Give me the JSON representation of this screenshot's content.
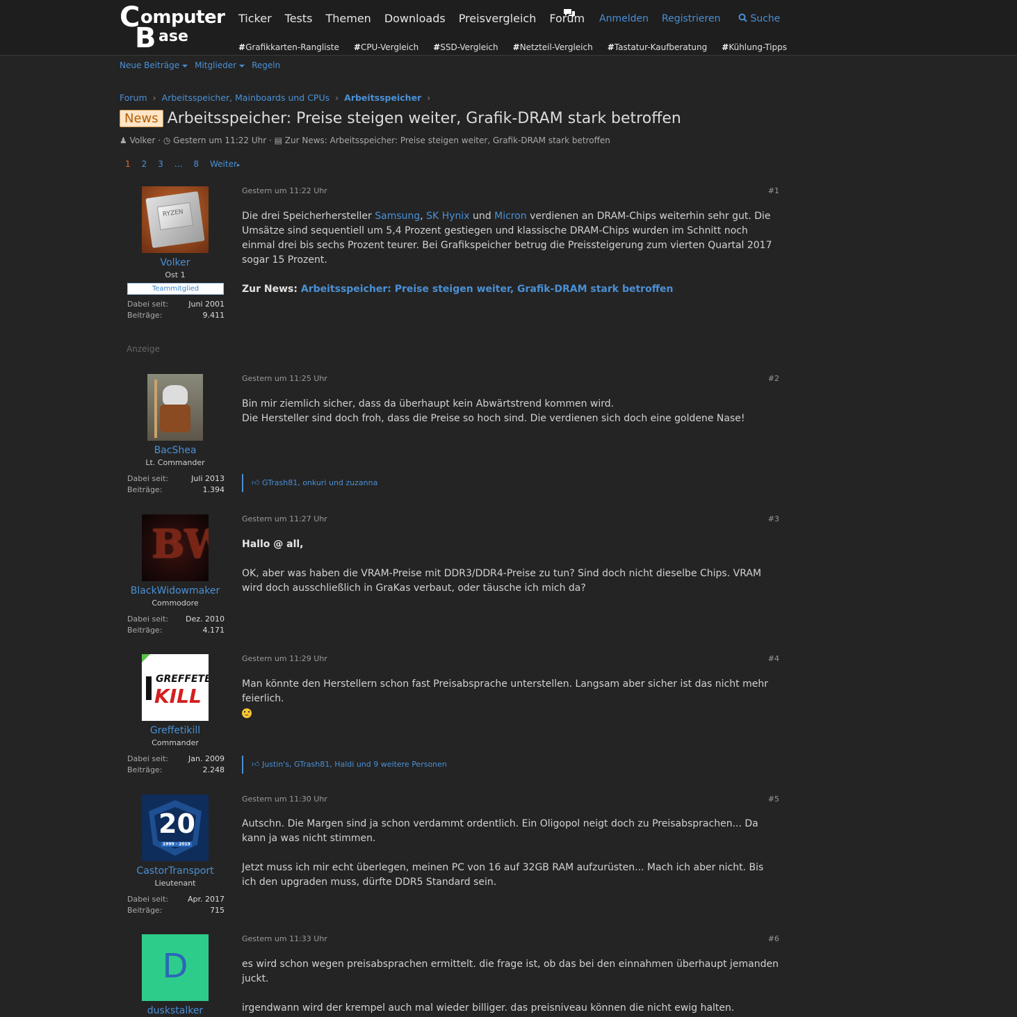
{
  "logo": {
    "line1": "C",
    "line1b": "omputer",
    "line2": "B",
    "line2b": "ase"
  },
  "nav": {
    "items": [
      "Ticker",
      "Tests",
      "Themen",
      "Downloads",
      "Preisvergleich",
      "Forum"
    ],
    "login": "Anmelden",
    "register": "Registrieren",
    "search": "Suche"
  },
  "hashtags": [
    "Grafikkarten-Rangliste",
    "CPU-Vergleich",
    "SSD-Vergleich",
    "Netzteil-Vergleich",
    "Tastatur-Kaufberatung",
    "Kühlung-Tipps"
  ],
  "subnav": {
    "new_posts": "Neue Beiträge",
    "members": "Mitglieder",
    "rules": "Regeln"
  },
  "breadcrumb": [
    "Forum",
    "Arbeitsspeicher, Mainboards und CPUs",
    "Arbeitsspeicher"
  ],
  "thread": {
    "tag": "News",
    "title": "Arbeitsspeicher: Preise steigen weiter, Grafik-DRAM stark betroffen",
    "author": "Volker",
    "date": "Gestern um 11:22 Uhr",
    "source": "Zur News: Arbeitsspeicher: Preise steigen weiter, Grafik-DRAM stark betroffen"
  },
  "pager": {
    "p1": "1",
    "p2": "2",
    "p3": "3",
    "dots": "...",
    "p8": "8",
    "next": "Weiter"
  },
  "ad_label": "Anzeige",
  "labels": {
    "since": "Dabei seit:",
    "posts": "Beiträge:"
  },
  "posts": [
    {
      "user": "Volker",
      "rank": "Ost 1",
      "badge": "Teammitglied",
      "since": "Juni 2001",
      "count": "9.411",
      "time": "Gestern um 11:22 Uhr",
      "num": "#1",
      "p1_a": "Die drei Speicherhersteller ",
      "l_samsung": "Samsung",
      "comma": ", ",
      "l_skhynix": "SK Hynix",
      "und": " und ",
      "l_micron": "Micron",
      "p1_b": " verdienen an DRAM-Chips weiterhin sehr gut. Die Umsätze sind sequentiell um 5,4 Prozent gestiegen und klassische DRAM-Chips wurden im Schnitt noch einmal drei bis sechs Prozent teurer. Bei Grafikspeicher betrug die Preissteigerung zum vierten Quartal 2017 sogar 15 Prozent.",
      "zur_news": "Zur News: ",
      "news_link": "Arbeitsspeicher: Preise steigen weiter, Grafik-DRAM stark betroffen"
    },
    {
      "user": "BacShea",
      "rank": "Lt. Commander",
      "since": "Juli 2013",
      "count": "1.394",
      "time": "Gestern um 11:25 Uhr",
      "num": "#2",
      "line1": "Bin mir ziemlich sicher, dass da überhaupt kein Abwärtstrend kommen wird.",
      "line2": "Die Hersteller sind doch froh, dass die Preise so hoch sind. Die verdienen sich doch eine goldene Nase!",
      "likes": "GTrash81, onkuri und zuzanna"
    },
    {
      "user": "BlackWidowmaker",
      "rank": "Commodore",
      "since": "Dez. 2010",
      "count": "4.171",
      "time": "Gestern um 11:27 Uhr",
      "num": "#3",
      "greeting": "Hallo @ all,",
      "para": "OK, aber was haben die VRAM-Preise mit DDR3/DDR4-Preise zu tun? Sind doch nicht dieselbe Chips. VRAM wird doch ausschließlich in GraKas verbaut, oder täusche ich mich da?"
    },
    {
      "user": "Greffetikill",
      "rank": "Commander",
      "since": "Jan. 2009",
      "count": "2.248",
      "time": "Gestern um 11:29 Uhr",
      "num": "#4",
      "para": "Man könnte den Herstellern schon fast Preisabsprache unterstellen. Langsam aber sicher ist das nicht mehr feierlich.",
      "likes": "Justin's, GTrash81, Haldi und 9 weitere Personen"
    },
    {
      "user": "CastorTransport",
      "rank": "Lieutenant",
      "since": "Apr. 2017",
      "count": "715",
      "time": "Gestern um 11:30 Uhr",
      "num": "#5",
      "para1": "Autschn. Die Margen sind ja schon verdammt ordentlich. Ein Oligopol neigt doch zu Preisabsprachen... Da kann ja was nicht stimmen.",
      "para2": "Jetzt muss ich mir echt überlegen, meinen PC von 16 auf 32GB RAM aufzurüsten... Mach ich aber nicht. Bis ich den upgraden muss, dürfte DDR5 Standard sein."
    },
    {
      "user": "duskstalker",
      "initial": "D",
      "time": "Gestern um 11:33 Uhr",
      "num": "#6",
      "para1": "es wird schon wegen preisabsprachen ermittelt. die frage ist, ob das bei den einnahmen überhaupt jemanden juckt.",
      "para2": "irgendwann wird der krempel auch mal wieder billiger. das preisniveau können die nicht ewig halten."
    }
  ],
  "avatars": {
    "p1_logo": "RYZEN",
    "p3_logo": "BW",
    "p4_line1": "GREFFETE",
    "p4_line2": "KILL",
    "p5_number": "20",
    "p5_years": "1999 · 2019"
  },
  "colors": {
    "link": "#4a90d6",
    "accent_orange": "#e06d2b",
    "avatar_d": "#2ecc8a"
  }
}
